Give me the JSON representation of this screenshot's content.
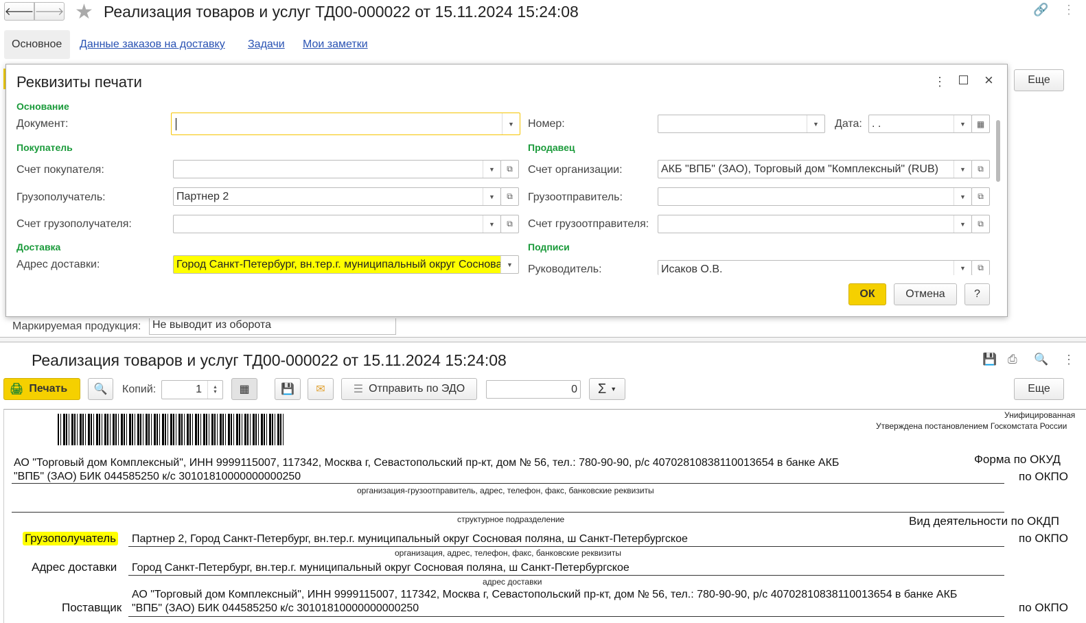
{
  "window": {
    "title": "Реализация товаров и услуг ТД00-000022 от 15.11.2024 15:24:08"
  },
  "tabs": [
    "Основное",
    "Данные заказов на доставку",
    "Задачи",
    "Мои заметки"
  ],
  "behind": {
    "label": "Маркируемая продукция:",
    "value": "Не выводит из оборота",
    "more": "Еще"
  },
  "dialog": {
    "title": "Реквизиты печати",
    "sections": {
      "basis": "Основание",
      "buyer": "Покупатель",
      "delivery": "Доставка",
      "seller": "Продавец",
      "signatures": "Подписи"
    },
    "fields": {
      "document": {
        "label": "Документ:",
        "value": ""
      },
      "number": {
        "label": "Номер:",
        "value": ""
      },
      "date": {
        "label": "Дата:",
        "value": " .  ."
      },
      "buyer_account": {
        "label": "Счет покупателя:",
        "value": ""
      },
      "consignee": {
        "label": "Грузополучатель:",
        "value": "Партнер 2"
      },
      "consignee_account": {
        "label": "Счет грузополучателя:",
        "value": ""
      },
      "delivery_address": {
        "label": "Адрес доставки:",
        "value": "Город Санкт-Петербург, вн.тер.г. муниципальный округ Сосновая поляна"
      },
      "org_account": {
        "label": "Счет организации:",
        "value": "АКБ \"ВПБ\" (ЗАО), Торговый дом \"Комплексный\" (RUB)"
      },
      "shipper": {
        "label": "Грузоотправитель:",
        "value": ""
      },
      "shipper_account": {
        "label": "Счет грузоотправителя:",
        "value": ""
      },
      "head": {
        "label": "Руководитель:",
        "value": "Исаков О.В."
      }
    },
    "ok": "ОК",
    "cancel": "Отмена",
    "help": "?"
  },
  "print": {
    "title": "Реализация товаров и услуг ТД00-000022 от 15.11.2024 15:24:08",
    "print_btn": "Печать",
    "copies_label": "Копий:",
    "copies": "1",
    "send_edo": "Отправить по ЭДО",
    "sum": "0",
    "more": "Еще"
  },
  "form": {
    "header1": "Унифицированная",
    "header2": "Утверждена постановлением Госкомстата России",
    "shipper_text1": "АО \"Торговый дом Комплексный\", ИНН 9999115007, 117342, Москва г, Севастопольский пр-кт, дом № 56, тел.: 780-90-90, р/с 40702810838110013654 в банке АКБ",
    "shipper_text2": "\"ВПБ\" (ЗАО) БИК 044585250 к/с 30101810000000000250",
    "okud": "Форма по ОКУД",
    "okpo": "по ОКПО",
    "cap_shipper": "организация-грузоотправитель, адрес, телефон, факс, банковские реквизиты",
    "cap_division": "структурное подразделение",
    "okdp": "Вид деятельности по ОКДП",
    "consignee_label": "Грузополучатель",
    "consignee_text": "Партнер 2, Город Санкт-Петербург, вн.тер.г. муниципальный округ Сосновая поляна, ш Санкт-Петербургское",
    "cap_org": "организация, адрес, телефон, факс, банковские реквизиты",
    "address_label": "Адрес доставки",
    "address_text": "Город Санкт-Петербург, вн.тер.г. муниципальный округ Сосновая поляна, ш Санкт-Петербургское",
    "cap_address": "адрес доставки",
    "supplier_label": "Поставщик",
    "supplier_text1": "АО \"Торговый дом Комплексный\", ИНН 9999115007, 117342, Москва г, Севастопольский пр-кт, дом № 56, тел.: 780-90-90, р/с 40702810838110013654 в банке АКБ",
    "supplier_text2": "\"ВПБ\" (ЗАО) БИК 044585250 к/с 30101810000000000250"
  },
  "colors": {
    "highlight": "#ffff00",
    "accent_yellow": "#f5d000",
    "section_green": "#1a9a3a",
    "link": "#2952b3"
  }
}
